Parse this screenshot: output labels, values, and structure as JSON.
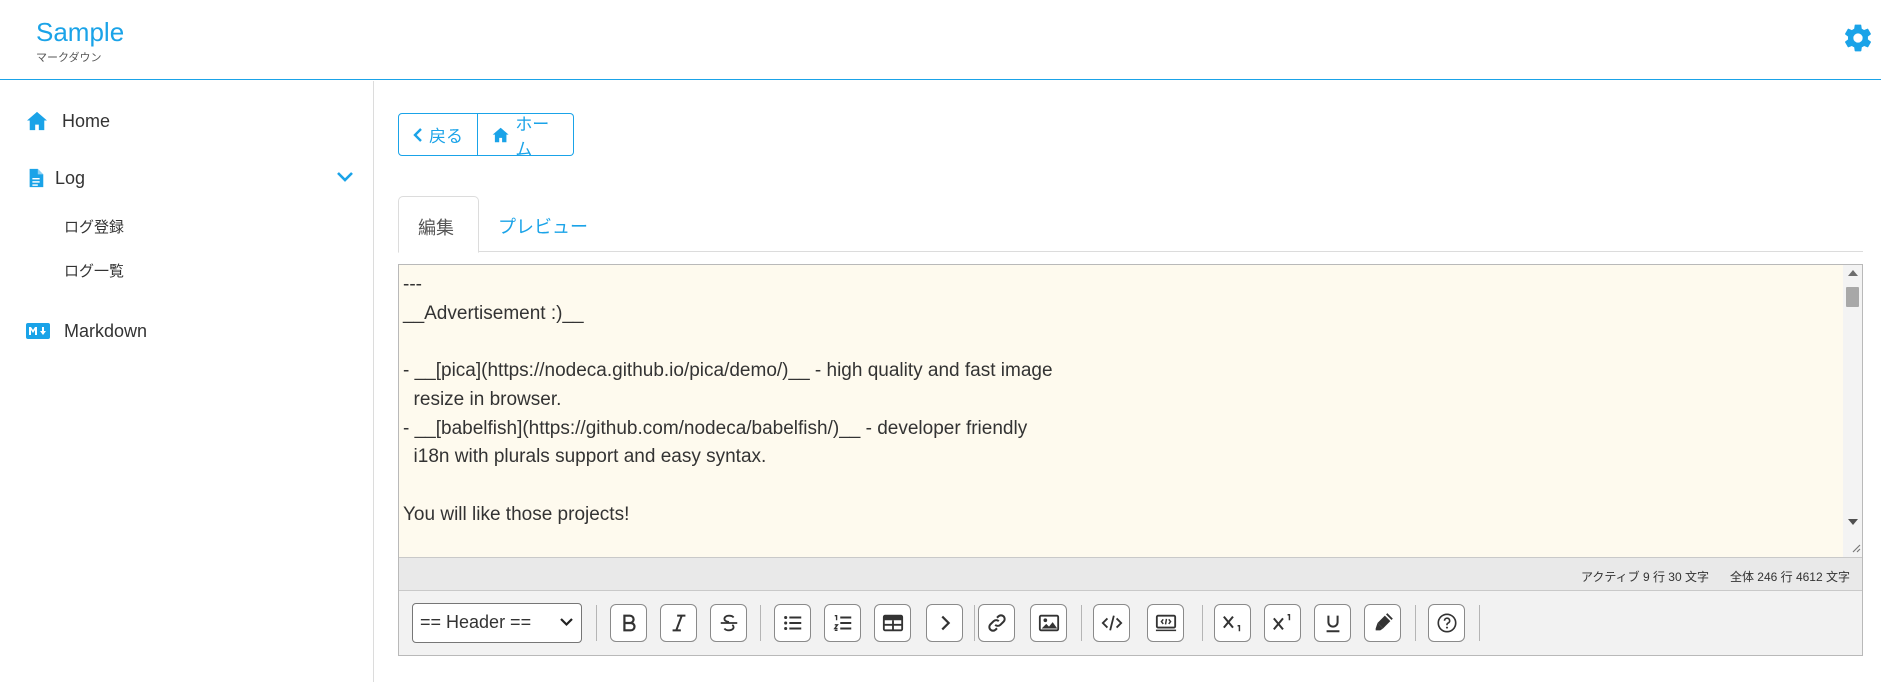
{
  "header": {
    "title": "Sample",
    "subtitle": "マークダウン",
    "settings_icon": "gear-icon"
  },
  "sidebar": {
    "items": [
      {
        "label": "Home",
        "icon": "home-icon"
      },
      {
        "label": "Log",
        "icon": "file-icon",
        "expanded": true,
        "children": [
          {
            "label": "ログ登録"
          },
          {
            "label": "ログ一覧"
          }
        ]
      },
      {
        "label": "Markdown",
        "icon": "markdown-icon"
      }
    ]
  },
  "nav_buttons": {
    "back_label": "戻る",
    "home_label": "ホーム"
  },
  "tabs": [
    {
      "label": "編集",
      "active": true
    },
    {
      "label": "プレビュー",
      "active": false
    }
  ],
  "editor": {
    "content": "---\n__Advertisement :)__\n\n- __[pica](https://nodeca.github.io/pica/demo/)__ - high quality and fast image\n  resize in browser.\n- __[babelfish](https://github.com/nodeca/babelfish/)__ - developer friendly\n  i18n with plurals support and easy syntax.\n\nYou will like those projects!",
    "status_active": "アクティブ 9 行 30 文字",
    "status_total": "全体 246 行 4612 文字"
  },
  "toolbar": {
    "header_select": "== Header ==",
    "buttons": [
      "bold",
      "italic",
      "strikethrough",
      "bullet-list",
      "numbered-list",
      "table",
      "blockquote",
      "link",
      "image",
      "code",
      "code-block",
      "subscript",
      "superscript",
      "underline",
      "highlight",
      "help"
    ]
  },
  "colors": {
    "accent": "#1aa3e8",
    "editor_bg": "#fefaee",
    "statusbar_bg": "#e9e9e9",
    "toolbar_bg": "#f2f2f2"
  }
}
